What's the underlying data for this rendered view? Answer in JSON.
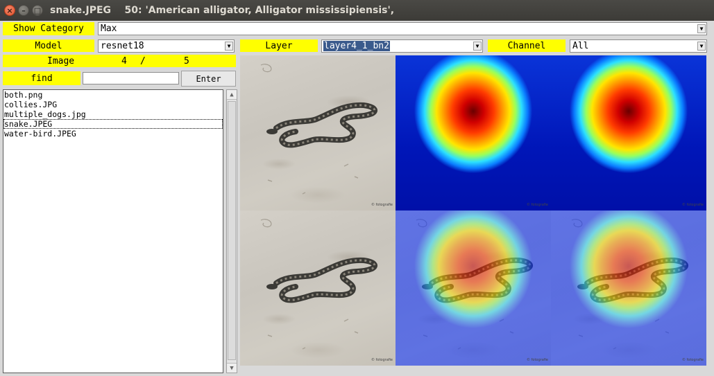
{
  "window": {
    "title": "snake.JPEG    50: 'American alligator, Alligator mississipiensis',",
    "close_glyph": "×",
    "minimize_glyph": "–",
    "maximize_glyph": "□"
  },
  "controls": {
    "show_category_label": "Show Category",
    "category_value": "Max",
    "model_label": "Model",
    "model_value": "resnet18",
    "layer_label": "Layer",
    "layer_value": "layer4_1_bn2",
    "channel_label": "Channel",
    "channel_value": "All",
    "image_label": "Image",
    "image_index": "4",
    "image_sep": "/",
    "image_total": "5",
    "find_label": "find",
    "find_value": "",
    "enter_label": "Enter"
  },
  "files": [
    {
      "name": "both.png",
      "selected": false
    },
    {
      "name": "collies.JPG",
      "selected": false
    },
    {
      "name": "multiple_dogs.jpg",
      "selected": false
    },
    {
      "name": "snake.JPEG",
      "selected": true
    },
    {
      "name": "water-bird.JPEG",
      "selected": false
    }
  ],
  "images": {
    "watermark": "© fotografie",
    "tiles": [
      "original",
      "heatmap",
      "heatmap",
      "original",
      "overlay",
      "overlay"
    ]
  },
  "icons": {
    "dropdown": "chevron-down-icon",
    "scroll_up": "scroll-up-icon",
    "scroll_down": "scroll-down-icon"
  },
  "colors": {
    "label_bg": "#ffff00",
    "titlebar_bg": "#3c3b37",
    "close_button": "#e0552f",
    "selection_bg": "#3a5a8c"
  }
}
